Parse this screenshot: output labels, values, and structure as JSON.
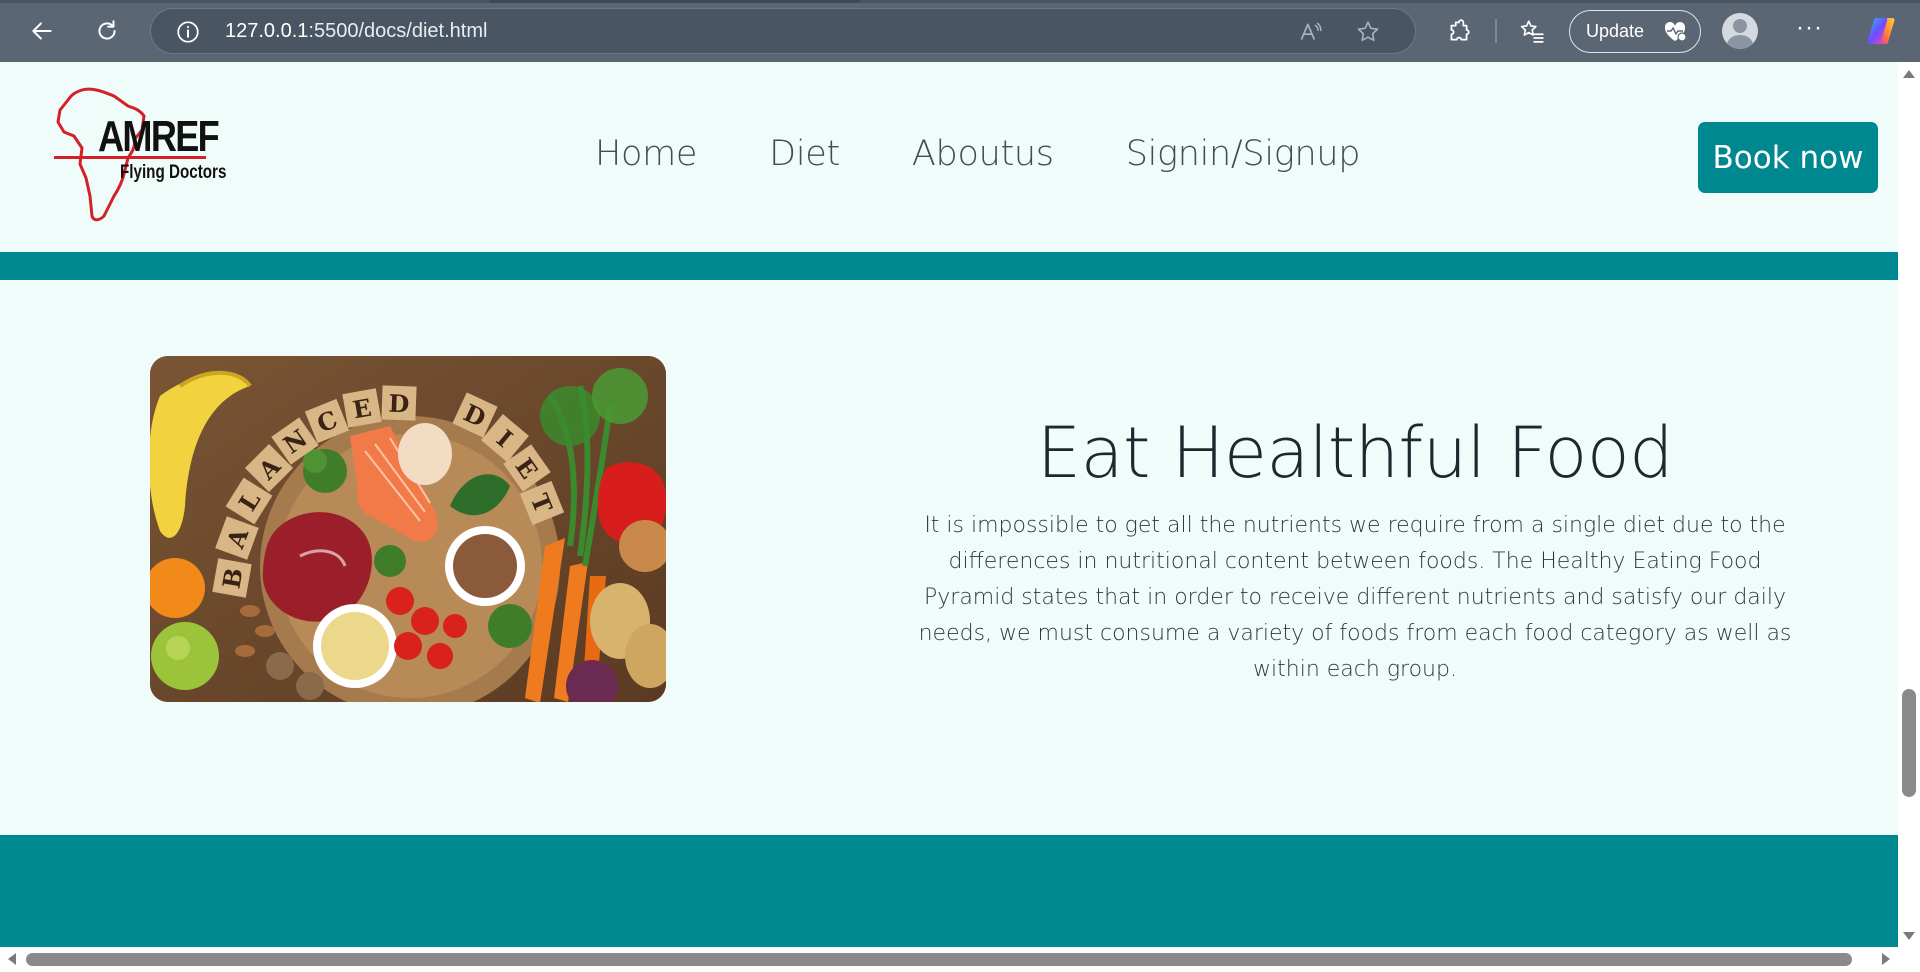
{
  "browser": {
    "url_host": "127.0.0.1",
    "url_path": ":5500/docs/diet.html",
    "update_label": "Update",
    "more_label": "···"
  },
  "site": {
    "logo_name": "AMREF",
    "logo_sub": "Flying Doctors",
    "nav": [
      "Home",
      "Diet",
      "Aboutus",
      "Signin/Signup"
    ],
    "book_label": "Book now"
  },
  "content": {
    "image_text_1": "BALANCED",
    "image_text_2": "DIET",
    "heading": "Eat Healthful Food",
    "paragraph": "It is impossible to get all the nutrients we require from a single diet due to the differences in nutritional content between foods. The Healthy Eating Food Pyramid states that in order to receive different nutrients and satisfy our daily needs, we must consume a variety of foods from each food category as well as within each group."
  },
  "colors": {
    "teal": "#008891",
    "page_bg": "#effcfa",
    "chrome_bg": "#5b6675"
  },
  "icons": [
    "back-icon",
    "reload-icon",
    "info-icon",
    "read-aloud-icon",
    "favorite-star-icon",
    "extensions-icon",
    "favorites-icon",
    "heart-pulse-icon",
    "profile-icon",
    "more-icon",
    "copilot-icon"
  ]
}
